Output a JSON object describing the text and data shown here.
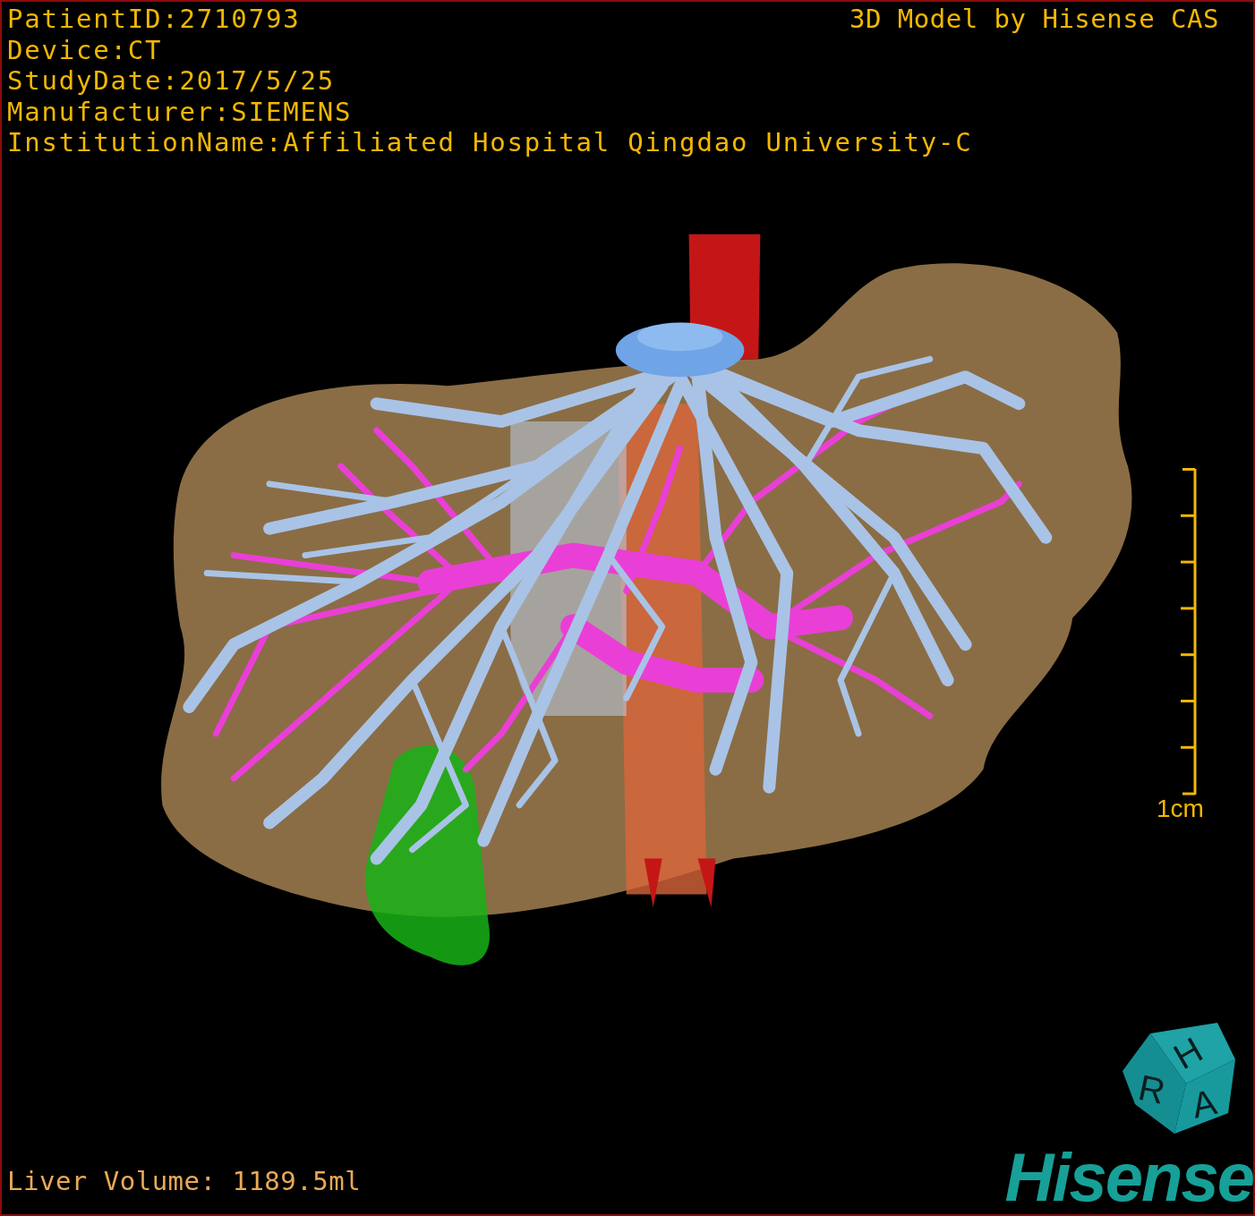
{
  "header": {
    "info_lines": [
      "PatientID:2710793",
      "Device:CT",
      "StudyDate:2017/5/25",
      "Manufacturer:SIEMENS",
      "InstitutionName:Affiliated Hospital Qingdao University-C"
    ],
    "title": "3D Model by Hisense CAS"
  },
  "scale_bar": {
    "label": "1cm"
  },
  "orientation_cube": {
    "faces": [
      "H",
      "R",
      "A"
    ]
  },
  "footer": {
    "volume": "Liver Volume: 1189.5ml",
    "logo": "Hisense"
  }
}
